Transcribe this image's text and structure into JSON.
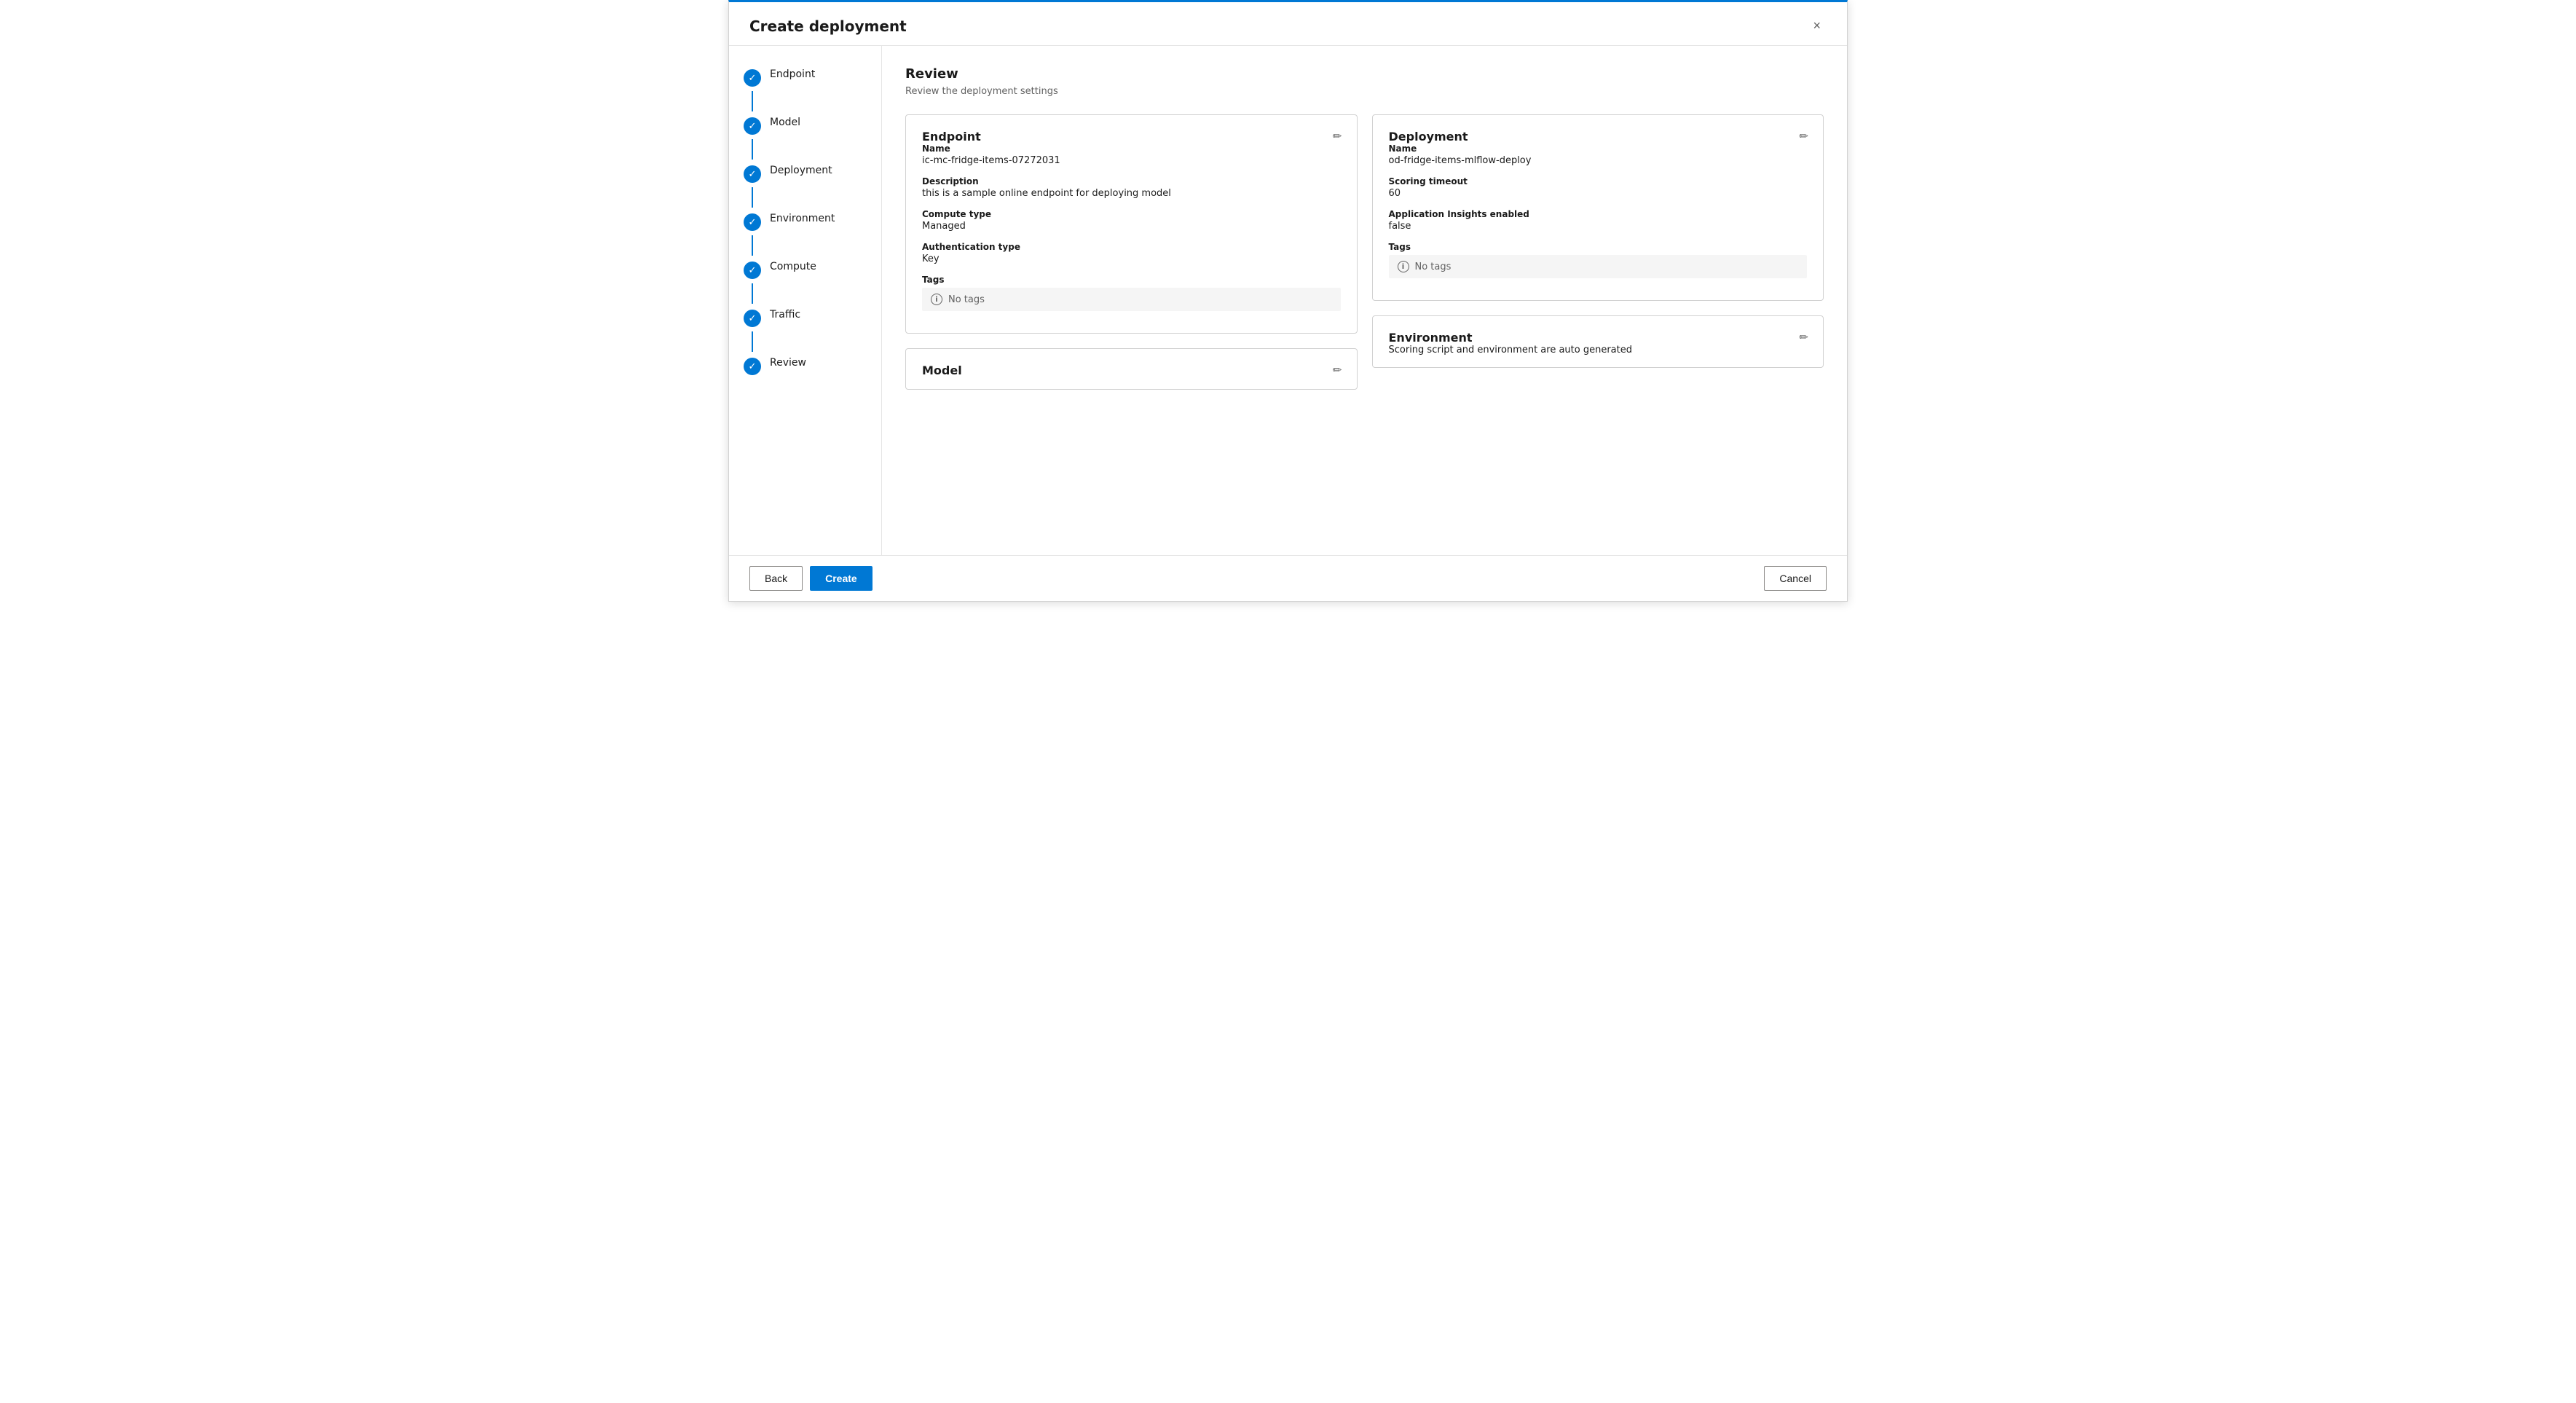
{
  "dialog": {
    "title": "Create deployment",
    "close_label": "×"
  },
  "sidebar": {
    "steps": [
      {
        "id": "endpoint",
        "label": "Endpoint",
        "completed": true
      },
      {
        "id": "model",
        "label": "Model",
        "completed": true
      },
      {
        "id": "deployment",
        "label": "Deployment",
        "completed": true
      },
      {
        "id": "environment",
        "label": "Environment",
        "completed": true
      },
      {
        "id": "compute",
        "label": "Compute",
        "completed": true
      },
      {
        "id": "traffic",
        "label": "Traffic",
        "completed": true
      },
      {
        "id": "review",
        "label": "Review",
        "completed": true
      }
    ]
  },
  "main": {
    "review": {
      "title": "Review",
      "subtitle": "Review the deployment settings",
      "endpoint_card": {
        "title": "Endpoint",
        "fields": [
          {
            "label": "Name",
            "value": "ic-mc-fridge-items-07272031"
          },
          {
            "label": "Description",
            "value": "this is a sample online endpoint for deploying model"
          },
          {
            "label": "Compute type",
            "value": "Managed"
          },
          {
            "label": "Authentication type",
            "value": "Key"
          }
        ],
        "tags_label": "Tags",
        "tags_empty": "No tags"
      },
      "model_card": {
        "title": "Model"
      },
      "deployment_card": {
        "title": "Deployment",
        "fields": [
          {
            "label": "Name",
            "value": "od-fridge-items-mlflow-deploy"
          },
          {
            "label": "Scoring timeout",
            "value": "60"
          },
          {
            "label": "Application Insights enabled",
            "value": "false"
          }
        ],
        "tags_label": "Tags",
        "tags_empty": "No tags"
      },
      "environment_card": {
        "title": "Environment",
        "description": "Scoring script and environment are auto generated"
      }
    }
  },
  "footer": {
    "back_label": "Back",
    "create_label": "Create",
    "cancel_label": "Cancel"
  }
}
